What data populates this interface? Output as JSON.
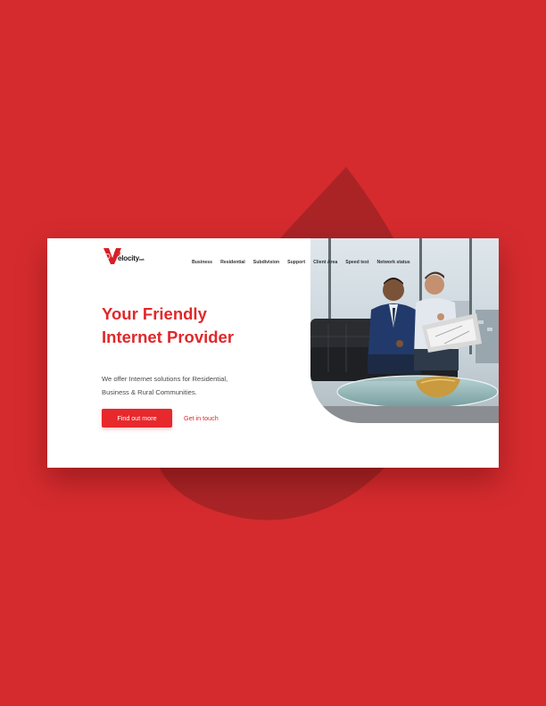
{
  "brand": {
    "logo_initial": "V",
    "logo_name": "elocity",
    "logo_suffix": "net"
  },
  "nav": {
    "items": [
      {
        "label": "Business"
      },
      {
        "label": "Residential"
      },
      {
        "label": "Subdivision"
      },
      {
        "label": "Support"
      },
      {
        "label": "Client Area"
      },
      {
        "label": "Speed test"
      },
      {
        "label": "Network status"
      }
    ]
  },
  "hero": {
    "title_line1": "Your Friendly",
    "title_line2": "Internet Provider",
    "description_line1": "We offer Internet solutions for Residential,",
    "description_line2": "Business & Rural Communities.",
    "primary_button": "Find out more",
    "secondary_link": "Get in touch"
  },
  "colors": {
    "brand_red": "#e0282b",
    "background_red": "#d52b2e",
    "drop_shadow_red": "#a82426",
    "card_white": "#ffffff"
  },
  "icons": {
    "logo": "velocity-logo-icon",
    "hero_image": "business-people-photo"
  }
}
